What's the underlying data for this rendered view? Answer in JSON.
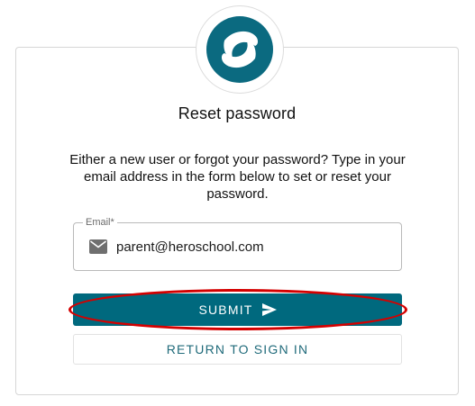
{
  "header": {
    "logo_icon": "wave-logo-icon",
    "title": "Reset password"
  },
  "form": {
    "description": "Either a new user or forgot your password? Type in your email address in the form below to set or reset your password.",
    "email": {
      "label": "Email*",
      "value": "parent@heroschool.com",
      "icon": "email-icon"
    },
    "submit_label": "SUBMIT",
    "submit_icon": "send-icon",
    "return_label": "RETURN TO SIGN IN"
  },
  "annotation": {
    "highlight_color": "#d40000"
  },
  "colors": {
    "primary": "#00697e",
    "logo": "#0b6a80"
  }
}
